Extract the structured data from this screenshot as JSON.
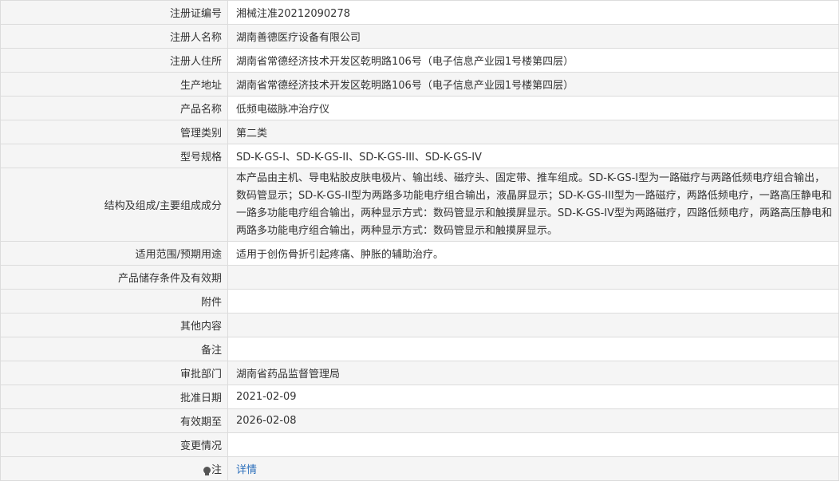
{
  "rows": [
    {
      "label": "注册证编号",
      "value": "湘械注准20212090278"
    },
    {
      "label": "注册人名称",
      "value": "湖南善德医疗设备有限公司"
    },
    {
      "label": "注册人住所",
      "value": "湖南省常德经济技术开发区乾明路106号（电子信息产业园1号楼第四层）"
    },
    {
      "label": "生产地址",
      "value": "湖南省常德经济技术开发区乾明路106号（电子信息产业园1号楼第四层）"
    },
    {
      "label": "产品名称",
      "value": "低频电磁脉冲治疗仪"
    },
    {
      "label": "管理类别",
      "value": "第二类"
    },
    {
      "label": "型号规格",
      "value": "SD-K-GS-I、SD-K-GS-II、SD-K-GS-III、SD-K-GS-IV"
    },
    {
      "label": "结构及组成/主要组成成分",
      "value": "本产品由主机、导电粘胶皮肤电极片、输出线、磁疗头、固定带、推车组成。SD-K-GS-I型为一路磁疗与两路低频电疗组合输出，数码管显示；SD-K-GS-II型为两路多功能电疗组合输出，液晶屏显示；SD-K-GS-III型为一路磁疗，两路低频电疗，一路高压静电和一路多功能电疗组合输出，两种显示方式：数码管显示和触摸屏显示。SD-K-GS-IV型为两路磁疗，四路低频电疗，两路高压静电和两路多功能电疗组合输出，两种显示方式：数码管显示和触摸屏显示。"
    },
    {
      "label": "适用范围/预期用途",
      "value": "适用于创伤骨折引起疼痛、肿胀的辅助治疗。"
    },
    {
      "label": "产品储存条件及有效期",
      "value": ""
    },
    {
      "label": "附件",
      "value": ""
    },
    {
      "label": "其他内容",
      "value": ""
    },
    {
      "label": "备注",
      "value": ""
    },
    {
      "label": "审批部门",
      "value": "湖南省药品监督管理局"
    },
    {
      "label": "批准日期",
      "value": "2021-02-09"
    },
    {
      "label": "有效期至",
      "value": "2026-02-08"
    },
    {
      "label": "变更情况",
      "value": ""
    }
  ],
  "note": {
    "label": "注",
    "icon": "lightbulb-icon",
    "link_text": "详情"
  },
  "colors": {
    "label_bg": "#f5f5f5",
    "border": "#dcdcdc",
    "link": "#2a6ebb",
    "text": "#333333"
  }
}
